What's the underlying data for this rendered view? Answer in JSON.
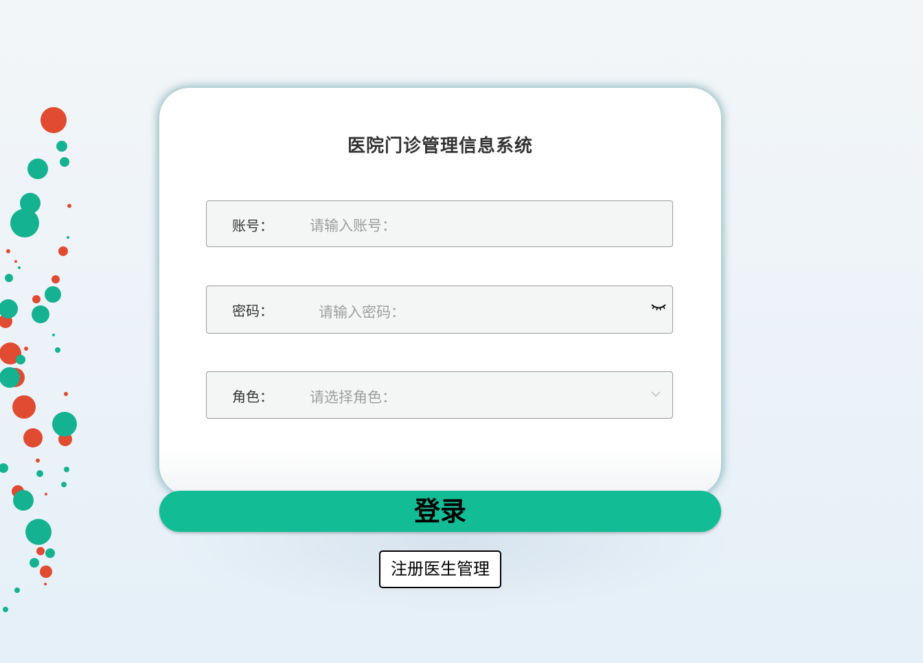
{
  "title": "医院门诊管理信息系统",
  "form": {
    "account": {
      "label": "账号：",
      "placeholder": "请输入账号："
    },
    "password": {
      "label": "密码：",
      "placeholder": "请输入密码："
    },
    "role": {
      "label": "角色：",
      "placeholder": "请选择角色："
    }
  },
  "buttons": {
    "login": "登录",
    "register": "注册医生管理"
  },
  "icons": {
    "password_toggle": "eye-closed-icon",
    "role_dropdown": "chevron-down-icon"
  },
  "colors": {
    "accent": "#12bc95",
    "dot_red": "#e04b32",
    "dot_green": "#15b292"
  }
}
